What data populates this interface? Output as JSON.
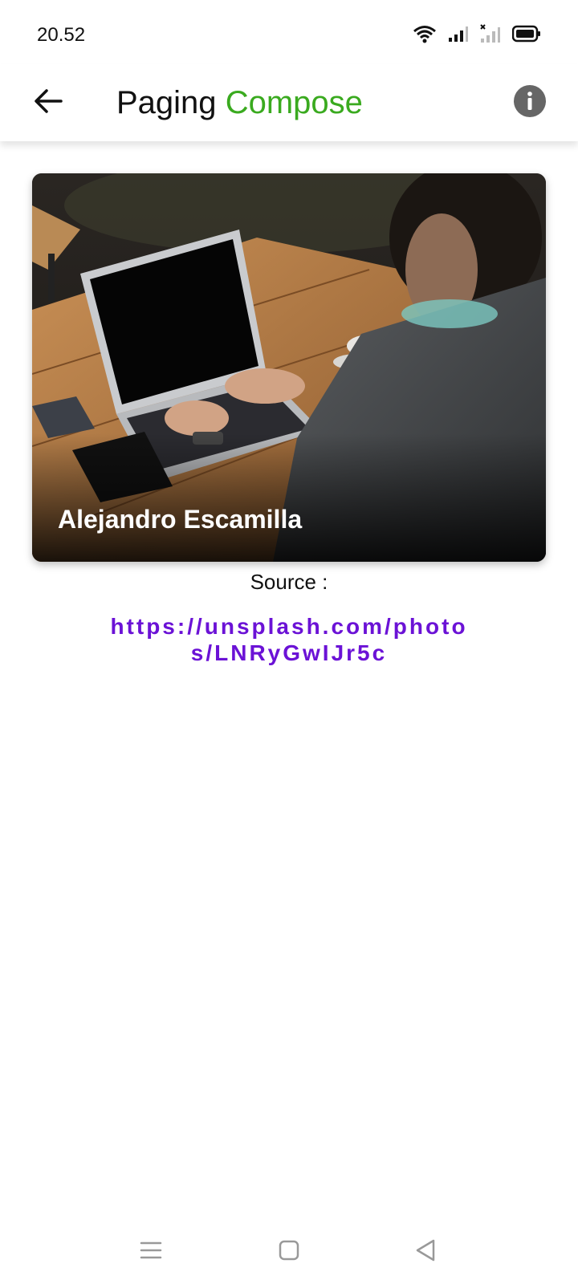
{
  "status_bar": {
    "time": "20.52",
    "icons": [
      "wifi-icon",
      "signal-icon",
      "no-signal-icon",
      "battery-icon"
    ]
  },
  "app_bar": {
    "title_part1": "Paging",
    "title_part2": "Compose",
    "accent_color": "#3aaa1f",
    "back_icon": "arrow-left-icon",
    "info_icon": "info-icon"
  },
  "card": {
    "author": "Alejandro Escamilla"
  },
  "source": {
    "label": "Source :",
    "url": "https://unsplash.com/photos/LNRyGwIJr5c",
    "link_color": "#6b12d6"
  },
  "nav_bar": {
    "icons": [
      "menu-icon",
      "home-icon",
      "back-triangle-icon"
    ]
  }
}
